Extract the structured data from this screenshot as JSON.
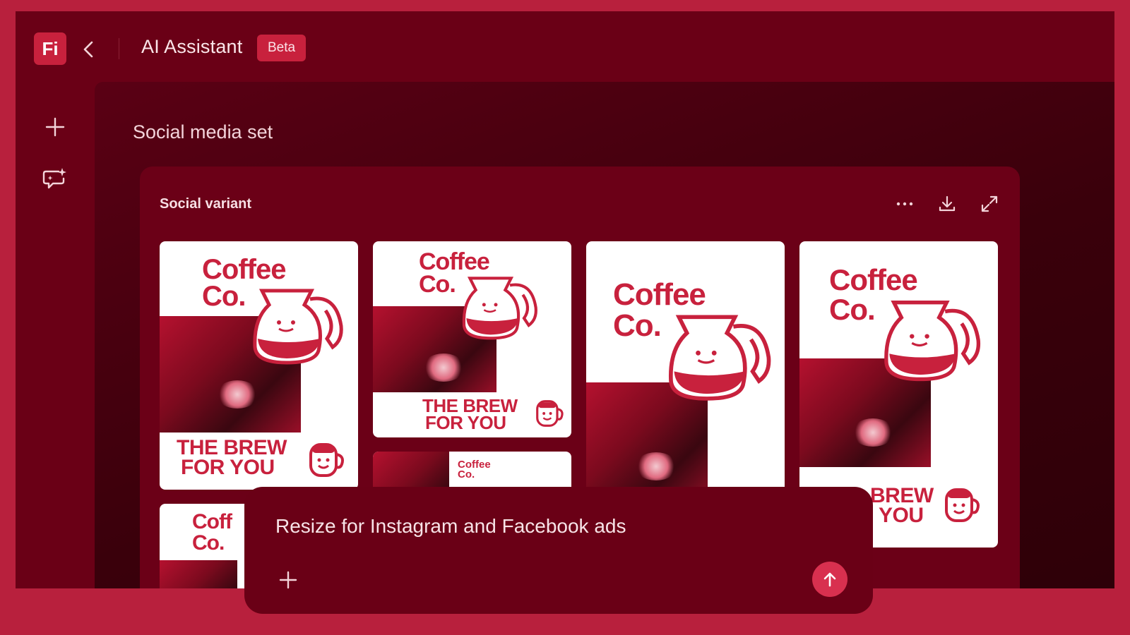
{
  "header": {
    "logo_text": "Fi",
    "title": "AI Assistant",
    "badge": "Beta"
  },
  "sidebar": {
    "icons": [
      "plus-icon",
      "chat-sparkle-icon"
    ]
  },
  "main": {
    "section_title": "Social media set",
    "card": {
      "title": "Social variant",
      "actions": [
        "more-icon",
        "download-icon",
        "expand-icon"
      ],
      "variants": [
        {
          "brand_line1": "Coffee",
          "brand_line2": "Co.",
          "tag_line1": "THE BREW",
          "tag_line2": "FOR YOU"
        },
        {
          "brand_line1": "Coffee",
          "brand_line2": "Co.",
          "tag_line1": "THE BREW",
          "tag_line2": "FOR YOU"
        },
        {
          "brand_line1": "Coffee",
          "brand_line2": "Co."
        },
        {
          "brand_line1": "Coffee",
          "brand_line2": "Co.",
          "tag_line1": "BREW",
          "tag_line2": "YOU"
        },
        {
          "brand_line1": "Coffee",
          "brand_line2": "Co."
        },
        {
          "brand_line1": "Coff",
          "brand_line2": "Co."
        }
      ]
    }
  },
  "prompt": {
    "text": "Resize for Instagram and Facebook ads",
    "add_icon": "plus-icon",
    "send_icon": "arrow-up-icon"
  },
  "colors": {
    "background": "#b8203d",
    "panel": "#6a0016",
    "accent": "#c8213d"
  }
}
